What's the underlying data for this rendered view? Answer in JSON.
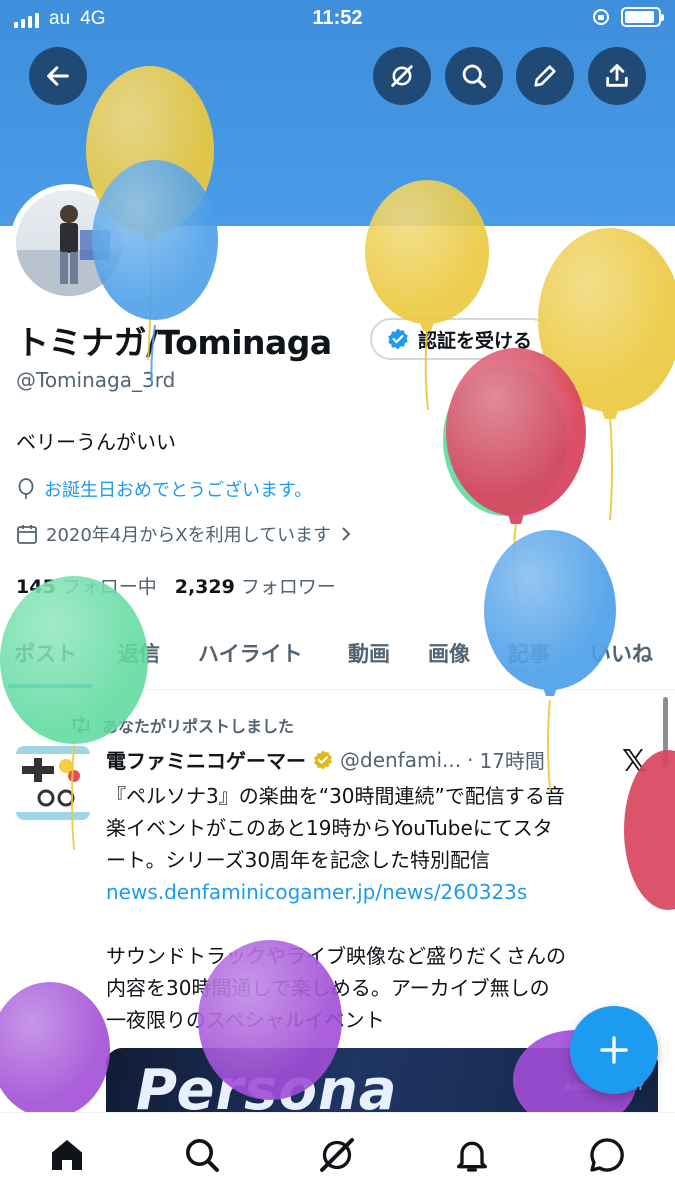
{
  "status_bar": {
    "carrier": "au",
    "network": "4G",
    "time": "11:52",
    "battery_level": 0.9
  },
  "header": {
    "back_icon": "arrow-left-icon",
    "grok_icon": "grok-icon",
    "search_icon": "search-icon",
    "edit_icon": "pencil-icon",
    "share_icon": "share-icon"
  },
  "profile": {
    "display_name": "トミナガ/Tominaga",
    "verify_button": "認証を受ける",
    "handle": "@Tominaga_3rd",
    "bio": "ベリーうんがいい",
    "birthday_message": "お誕生日おめでとうございます。",
    "joined": "2020年4月からXを利用しています",
    "following_count": "145",
    "following_label": "フォロー中",
    "followers_count": "2,329",
    "followers_label": "フォロワー"
  },
  "tabs": [
    {
      "label": "ポスト",
      "active": true
    },
    {
      "label": "返信",
      "active": false
    },
    {
      "label": "ハイライト",
      "active": false
    },
    {
      "label": "動画",
      "active": false
    },
    {
      "label": "画像",
      "active": false
    },
    {
      "label": "記事",
      "active": false
    },
    {
      "label": "いいね",
      "active": false
    }
  ],
  "tweet": {
    "repost_label": "あなたがリポストしました",
    "author_name": "電ファミニコゲーマー",
    "author_handle": "@denfami...",
    "time": "17時間",
    "text_line1": "『ペルソナ3』の楽曲を“30時間連続”で配信する音",
    "text_line2": "楽イベントがこのあと19時からYouTubeにてスタ",
    "text_line3": "ート。シリーズ30周年を記念した特別配信",
    "link": "news.denfaminicogamer.jp/news/260323s",
    "para2_line1": "サウンドトラックやライブ映像など盛りだくさんの",
    "para2_line2": "内容を30時間通しで楽しめる。アーカイブ無しの",
    "para2_line3": "一夜限りのスペシャルイベント",
    "card_title": "Persona",
    "card_sub": "ANNIVERSARY"
  },
  "colors": {
    "accent": "#1d9bf0",
    "banner": "#4a9be8",
    "balloon_yellow": "#ecc93e",
    "balloon_blue": "#4a9ee9",
    "balloon_red": "#d9455f",
    "balloon_green": "#5fdba0",
    "balloon_purple": "#a24ed8"
  },
  "bottom_nav": {
    "home_icon": "home-icon",
    "search_icon": "search-icon",
    "grok_icon": "grok-icon",
    "notifications_icon": "bell-icon",
    "messages_icon": "message-icon"
  }
}
